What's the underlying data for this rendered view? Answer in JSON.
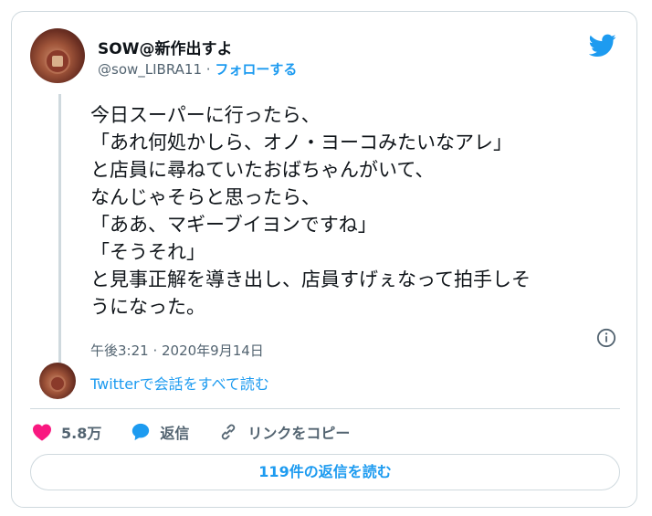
{
  "user": {
    "name": "SOW@新作出すよ",
    "handle": "@sow_LIBRA11",
    "separator": "·",
    "follow_label": "フォローする"
  },
  "tweet": {
    "lines": [
      "今日スーパーに行ったら、",
      "「あれ何処かしら、オノ・ヨーコみたいなアレ」",
      "と店員に尋ねていたおばちゃんがいて、",
      "なんじゃそらと思ったら、",
      "「ああ、マギーブイヨンですね」",
      "「そうそれ」",
      "と見事正解を導き出し、店員すげぇなって拍手しそ",
      "うになった。"
    ],
    "timestamp": "午後3:21 · 2020年9月14日"
  },
  "conversation_link": "Twitterで会話をすべて読む",
  "actions": {
    "likes_count": "5.8万",
    "reply_label": "返信",
    "copy_link_label": "リンクをコピー"
  },
  "read_replies_label": "119件の返信を読む",
  "colors": {
    "accent": "#1d9bf0",
    "heart": "#f91880",
    "text": "#0f1419",
    "secondary": "#536471",
    "border": "#cfd9de"
  },
  "icons": [
    "twitter-bird-icon",
    "info-icon",
    "heart-icon",
    "reply-bubble-icon",
    "link-icon"
  ]
}
